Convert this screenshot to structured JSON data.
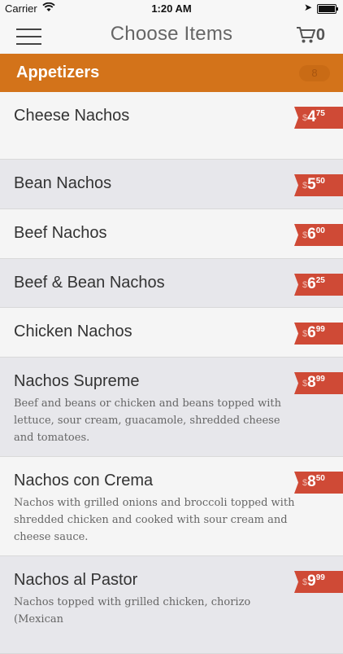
{
  "status_bar": {
    "carrier": "Carrier",
    "time": "1:20 AM"
  },
  "nav": {
    "title": "Choose Items",
    "cart_count": "0"
  },
  "section": {
    "title": "Appetizers",
    "count": "8"
  },
  "colors": {
    "accent_orange": "#d3731a",
    "price_tag": "#cf4a36"
  },
  "items": [
    {
      "name": "Cheese Nachos",
      "currency": "$",
      "price_whole": "4",
      "price_cents": "75",
      "description": ""
    },
    {
      "name": "Bean Nachos",
      "currency": "$",
      "price_whole": "5",
      "price_cents": "50",
      "description": ""
    },
    {
      "name": "Beef Nachos",
      "currency": "$",
      "price_whole": "6",
      "price_cents": "00",
      "description": ""
    },
    {
      "name": "Beef & Bean Nachos",
      "currency": "$",
      "price_whole": "6",
      "price_cents": "25",
      "description": ""
    },
    {
      "name": "Chicken Nachos",
      "currency": "$",
      "price_whole": "6",
      "price_cents": "99",
      "description": ""
    },
    {
      "name": "Nachos Supreme",
      "currency": "$",
      "price_whole": "8",
      "price_cents": "99",
      "description": "Beef and beans or chicken and beans topped with lettuce, sour cream, guacamole, shredded cheese and tomatoes."
    },
    {
      "name": "Nachos con Crema",
      "currency": "$",
      "price_whole": "8",
      "price_cents": "50",
      "description": "Nachos with grilled onions and broccoli topped with shredded chicken and cooked with sour cream and cheese sauce."
    },
    {
      "name": "Nachos al Pastor",
      "currency": "$",
      "price_whole": "9",
      "price_cents": "99",
      "description": "Nachos topped with grilled chicken, chorizo (Mexican"
    }
  ]
}
